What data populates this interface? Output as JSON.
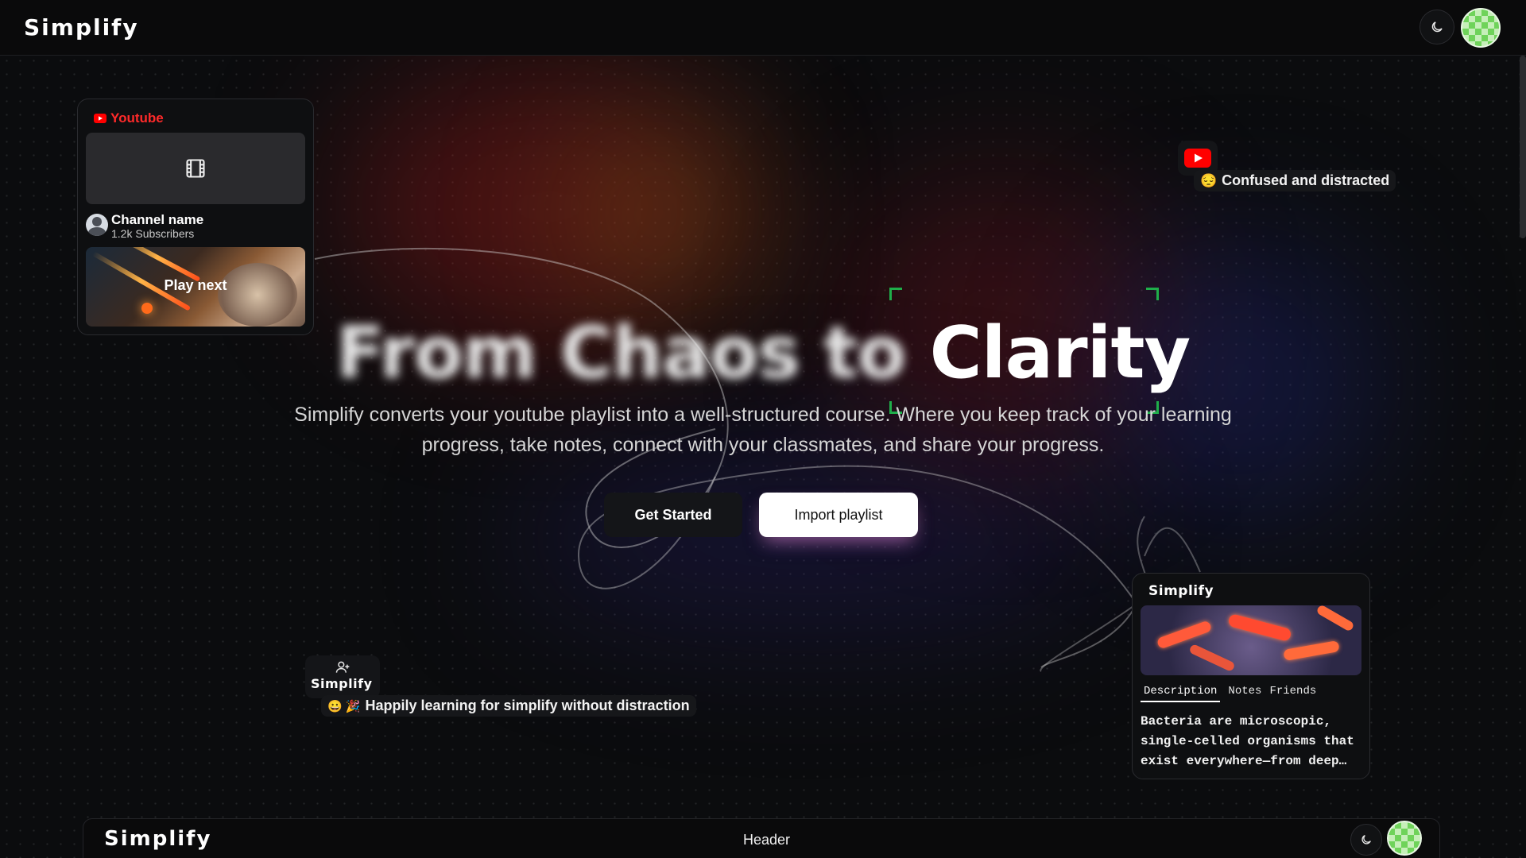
{
  "app": {
    "brand": "Simplify"
  },
  "topbar": {
    "theme_icon": "moon-icon"
  },
  "youtube_card": {
    "source_label": "Youtube",
    "channel_name": "Channel name",
    "subscribers": "1.2k Subscribers",
    "play_next": "Play next"
  },
  "floating_badge_top": {
    "text": "Confused and distracted",
    "emoji": "😔"
  },
  "hero": {
    "title_blurred": "From Chaos to",
    "title_clear": "Clarity",
    "description": "Simplify converts your youtube playlist into a well-structured course. Where you keep track of your learning progress, take notes, connect with your classmates, and share your progress."
  },
  "actions": {
    "get_started": "Get Started",
    "import_playlist": "Import playlist"
  },
  "floating_badge_bottom": {
    "brand": "Simplify",
    "text": "Happily learning for simplify without distraction",
    "emojis": "😀 🎉"
  },
  "simplify_card": {
    "brand": "Simplify",
    "tabs": [
      "Description",
      "Notes",
      "Friends"
    ],
    "body": "Bacteria are microscopic, single-celled organisms that exist everywhere—from deep…"
  },
  "bottom_bar": {
    "brand": "Simplify",
    "center_label": "Header"
  },
  "colors": {
    "youtube_red": "#ff0000",
    "accent_green": "#1fae4a",
    "background": "#0b0c0e"
  }
}
